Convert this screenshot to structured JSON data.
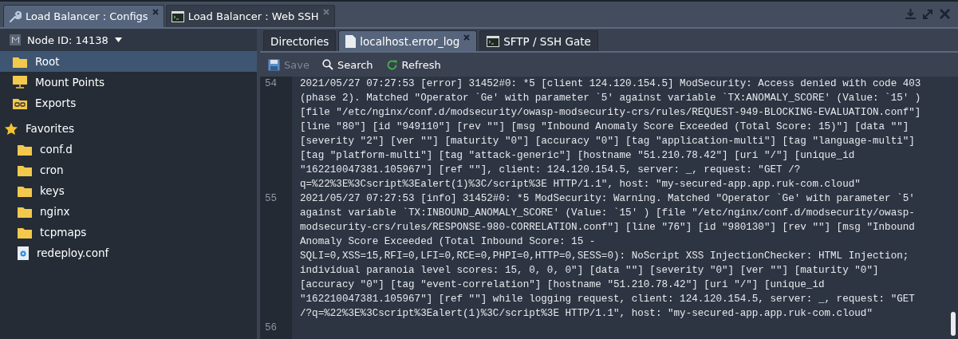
{
  "window_tabs": [
    {
      "label": "Load Balancer : Configs",
      "selected": true,
      "closable": true
    },
    {
      "label": "Load Balancer : Web SSH",
      "selected": false,
      "closable": true
    }
  ],
  "sidebar": {
    "node": "Node ID: 14138",
    "items": [
      {
        "label": "Root",
        "kind": "folder",
        "selected": true
      },
      {
        "label": "Mount Points",
        "kind": "mount",
        "selected": false
      },
      {
        "label": "Exports",
        "kind": "export",
        "selected": false
      }
    ],
    "favorites": {
      "label": "Favorites",
      "children": [
        {
          "label": "conf.d",
          "kind": "folder",
          "selected": false
        },
        {
          "label": "cron",
          "kind": "folder",
          "selected": false
        },
        {
          "label": "keys",
          "kind": "folder",
          "selected": false
        },
        {
          "label": "nginx",
          "kind": "folder",
          "selected": false
        },
        {
          "label": "tcpmaps",
          "kind": "folder",
          "selected": false
        },
        {
          "label": "redeploy.conf",
          "kind": "file",
          "selected": false
        }
      ]
    }
  },
  "editor_tabs": [
    {
      "label": "Directories",
      "selected": false,
      "closable": false
    },
    {
      "label": "localhost.error_log",
      "selected": true,
      "closable": true
    },
    {
      "label": "SFTP / SSH Gate",
      "selected": false,
      "closable": false
    }
  ],
  "toolbar": [
    {
      "label": "Save",
      "disabled": true
    },
    {
      "label": "Search",
      "disabled": false
    },
    {
      "label": "Refresh",
      "disabled": false
    }
  ],
  "log": [
    {
      "number": "54",
      "lines": [
        "2021/05/27 07:27:53 [error] 31452#0: *5 [client 124.120.154.5] ModSecurity: Access denied with code 403",
        "(phase 2). Matched \"Operator `Ge' with parameter `5' against variable `TX:ANOMALY_SCORE' (Value: `15' )",
        "[file \"/etc/nginx/conf.d/modsecurity/owasp-modsecurity-crs/rules/REQUEST-949-BLOCKING-EVALUATION.conf\"]",
        "[line \"80\"] [id \"949110\"] [rev \"\"] [msg \"Inbound Anomaly Score Exceeded (Total Score: 15)\"] [data \"\"]",
        "[severity \"2\"] [ver \"\"] [maturity \"0\"] [accuracy \"0\"] [tag \"application-multi\"] [tag \"language-multi\"]",
        "[tag \"platform-multi\"] [tag \"attack-generic\"] [hostname \"51.210.78.42\"] [uri \"/\"] [unique_id",
        "\"162210047381.105967\"] [ref \"\"], client: 124.120.154.5, server: _, request: \"GET /?",
        "q=%22%3E%3Cscript%3Ealert(1)%3C/script%3E HTTP/1.1\", host: \"my-secured-app.app.ruk-com.cloud\""
      ]
    },
    {
      "number": "55",
      "lines": [
        "2021/05/27 07:27:53 [info] 31452#0: *5 ModSecurity: Warning. Matched \"Operator `Ge' with parameter `5'",
        "against variable `TX:INBOUND_ANOMALY_SCORE' (Value: `15' ) [file \"/etc/nginx/conf.d/modsecurity/owasp-",
        "modsecurity-crs/rules/RESPONSE-980-CORRELATION.conf\"] [line \"76\"] [id \"980130\"] [rev \"\"] [msg \"Inbound",
        "Anomaly Score Exceeded (Total Inbound Score: 15 -",
        "SQLI=0,XSS=15,RFI=0,LFI=0,RCE=0,PHPI=0,HTTP=0,SESS=0): NoScript XSS InjectionChecker: HTML Injection;",
        "individual paranoia level scores: 15, 0, 0, 0\"] [data \"\"] [severity \"0\"] [ver \"\"] [maturity \"0\"]",
        "[accuracy \"0\"] [tag \"event-correlation\"] [hostname \"51.210.78.42\"] [uri \"/\"] [unique_id",
        "\"162210047381.105967\"] [ref \"\"] while logging request, client: 124.120.154.5, server: _, request: \"GET",
        "/?q=%22%3E%3Cscript%3Ealert(1)%3C/script%3E HTTP/1.1\", host: \"my-secured-app.app.ruk-com.cloud\""
      ]
    },
    {
      "number": "56"
    }
  ]
}
